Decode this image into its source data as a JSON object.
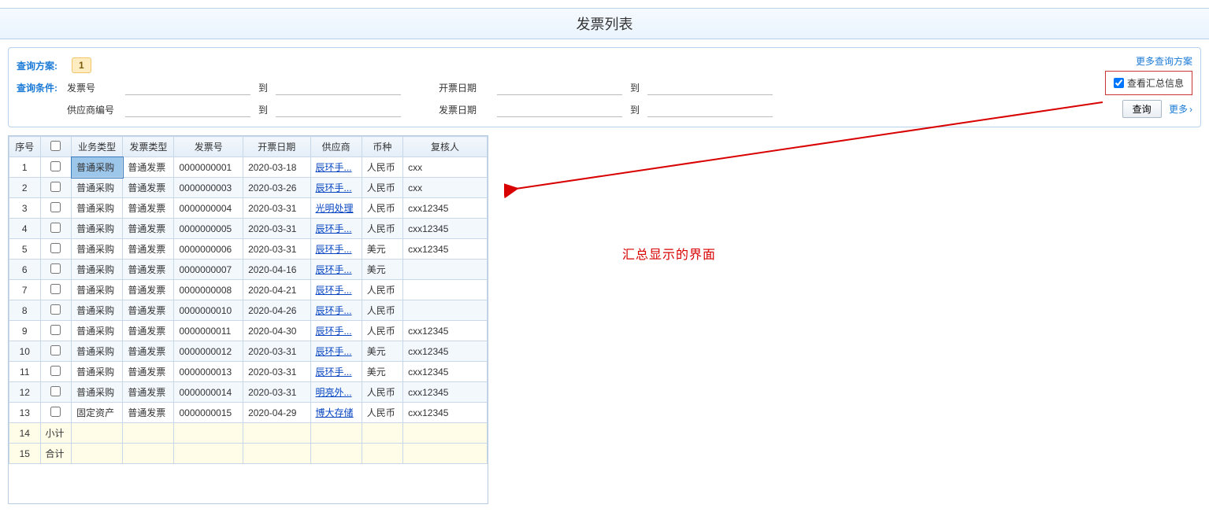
{
  "title": "发票列表",
  "query": {
    "schemeLabel": "查询方案:",
    "schemeBadge": "1",
    "condLabel": "查询条件:",
    "invoiceNoLabel": "发票号",
    "toLabel": "到",
    "invoiceDateLabel": "开票日期",
    "supplierNoLabel": "供应商编号",
    "billDateLabel": "发票日期",
    "moreSchemes": "更多查询方案",
    "summaryChk": "查看汇总信息",
    "searchBtn": "查询",
    "moreBtn": "更多"
  },
  "annotation": "汇总显示的界面",
  "table": {
    "headers": {
      "seq": "序号",
      "chk": "",
      "bizType": "业务类型",
      "invType": "发票类型",
      "invNo": "发票号",
      "invDate": "开票日期",
      "supplier": "供应商",
      "currency": "币种",
      "reviewer": "复核人"
    },
    "rows": [
      {
        "seq": "1",
        "bizType": "普通采购",
        "invType": "普通发票",
        "invNo": "0000000001",
        "invDate": "2020-03-18",
        "supplier": "辰环手...",
        "currency": "人民币",
        "reviewer": "cxx"
      },
      {
        "seq": "2",
        "bizType": "普通采购",
        "invType": "普通发票",
        "invNo": "0000000003",
        "invDate": "2020-03-26",
        "supplier": "辰环手...",
        "currency": "人民币",
        "reviewer": "cxx"
      },
      {
        "seq": "3",
        "bizType": "普通采购",
        "invType": "普通发票",
        "invNo": "0000000004",
        "invDate": "2020-03-31",
        "supplier": "光明处理",
        "currency": "人民币",
        "reviewer": "cxx12345"
      },
      {
        "seq": "4",
        "bizType": "普通采购",
        "invType": "普通发票",
        "invNo": "0000000005",
        "invDate": "2020-03-31",
        "supplier": "辰环手...",
        "currency": "人民币",
        "reviewer": "cxx12345"
      },
      {
        "seq": "5",
        "bizType": "普通采购",
        "invType": "普通发票",
        "invNo": "0000000006",
        "invDate": "2020-03-31",
        "supplier": "辰环手...",
        "currency": "美元",
        "reviewer": "cxx12345"
      },
      {
        "seq": "6",
        "bizType": "普通采购",
        "invType": "普通发票",
        "invNo": "0000000007",
        "invDate": "2020-04-16",
        "supplier": "辰环手...",
        "currency": "美元",
        "reviewer": ""
      },
      {
        "seq": "7",
        "bizType": "普通采购",
        "invType": "普通发票",
        "invNo": "0000000008",
        "invDate": "2020-04-21",
        "supplier": "辰环手...",
        "currency": "人民币",
        "reviewer": ""
      },
      {
        "seq": "8",
        "bizType": "普通采购",
        "invType": "普通发票",
        "invNo": "0000000010",
        "invDate": "2020-04-26",
        "supplier": "辰环手...",
        "currency": "人民币",
        "reviewer": ""
      },
      {
        "seq": "9",
        "bizType": "普通采购",
        "invType": "普通发票",
        "invNo": "0000000011",
        "invDate": "2020-04-30",
        "supplier": "辰环手...",
        "currency": "人民币",
        "reviewer": "cxx12345"
      },
      {
        "seq": "10",
        "bizType": "普通采购",
        "invType": "普通发票",
        "invNo": "0000000012",
        "invDate": "2020-03-31",
        "supplier": "辰环手...",
        "currency": "美元",
        "reviewer": "cxx12345"
      },
      {
        "seq": "11",
        "bizType": "普通采购",
        "invType": "普通发票",
        "invNo": "0000000013",
        "invDate": "2020-03-31",
        "supplier": "辰环手...",
        "currency": "美元",
        "reviewer": "cxx12345"
      },
      {
        "seq": "12",
        "bizType": "普通采购",
        "invType": "普通发票",
        "invNo": "0000000014",
        "invDate": "2020-03-31",
        "supplier": "明亮外...",
        "currency": "人民币",
        "reviewer": "cxx12345"
      },
      {
        "seq": "13",
        "bizType": "固定资产",
        "invType": "普通发票",
        "invNo": "0000000015",
        "invDate": "2020-04-29",
        "supplier": "博大存储",
        "currency": "人民币",
        "reviewer": "cxx12345"
      }
    ],
    "subtotal": {
      "seq": "14",
      "label": "小计"
    },
    "total": {
      "seq": "15",
      "label": "合计"
    }
  }
}
